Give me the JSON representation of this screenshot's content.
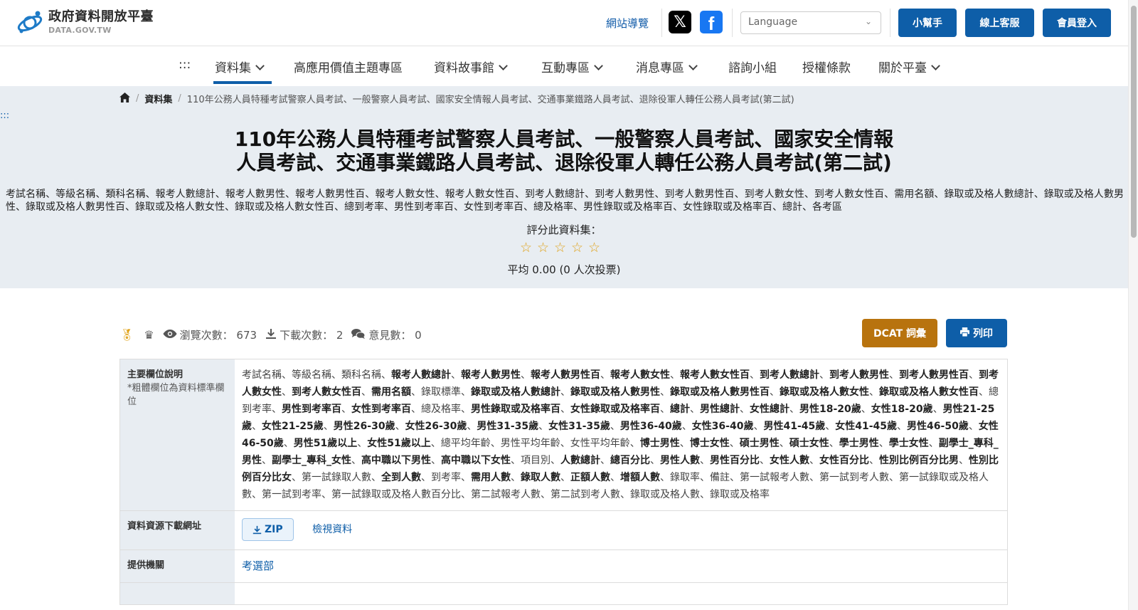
{
  "header": {
    "logo_cn": "政府資料開放平臺",
    "logo_en": "DATA.GOV.TW",
    "site_guide": "網站導覽",
    "language_placeholder": "Language",
    "buttons": {
      "helper": "小幫手",
      "support": "線上客服",
      "login": "會員登入"
    },
    "brand_color": "#0e5ea8"
  },
  "nav": {
    "accesskey": ":::",
    "items": [
      {
        "label": "資料集",
        "has_dropdown": true,
        "active": true
      },
      {
        "label": "高應用價值主題專區",
        "has_dropdown": false
      },
      {
        "label": "資料故事館",
        "has_dropdown": true
      },
      {
        "label": "互動專區",
        "has_dropdown": true
      },
      {
        "label": "消息專區",
        "has_dropdown": true
      },
      {
        "label": "諮詢小組",
        "has_dropdown": false
      },
      {
        "label": "授權條款",
        "has_dropdown": false
      },
      {
        "label": "關於平臺",
        "has_dropdown": true
      }
    ]
  },
  "breadcrumb": {
    "section": "資料集",
    "current": "110年公務人員特種考試警察人員考試、一般警察人員考試、國家安全情報人員考試、交通事業鐵路人員考試、退除役軍人轉任公務人員考試(第二試)"
  },
  "accesskey_content": ":::",
  "dataset": {
    "title_line1": "110年公務人員特種考試警察人員考試、一般警察人員考試、國家安全情報",
    "title_line2": "人員考試、交通事業鐵路人員考試、退除役軍人轉任公務人員考試(第二試)",
    "summary": "考試名稱、等級名稱、類科名稱、報考人數總計、報考人數男性、報考人數男性百、報考人數女性、報考人數女性百、到考人數總計、到考人數男性、到考人數男性百、到考人數女性、到考人數女性百、需用名額、錄取或及格人數總計、錄取或及格人數男性、錄取或及格人數男性百、錄取或及格人數女性、錄取或及格人數女性百、總到考率、男性到考率百、女性到考率百、總及格率、男性錄取或及格率百、女性錄取或及格率百、總計、各考區",
    "rate_label": "評分此資料集：",
    "rating_stars": 0,
    "rate_avg": "平均 0.00 (0 人次投票)"
  },
  "stats": {
    "views": "瀏覽次數： 673",
    "downloads": "下載次數： 2",
    "comments": "意見數： 0",
    "dcat_button": "DCAT 詞彙",
    "print_button": "列印",
    "dcat_color": "#b8730e"
  },
  "meta": {
    "fields_label": "主要欄位說明",
    "fields_note": "*粗體欄位為資料標準欄位",
    "fields": [
      {
        "t": "考試名稱",
        "b": false
      },
      {
        "t": "等級名稱",
        "b": false
      },
      {
        "t": "類科名稱",
        "b": false
      },
      {
        "t": "報考人數總計",
        "b": true
      },
      {
        "t": "報考人數男性",
        "b": true
      },
      {
        "t": "報考人數男性百",
        "b": true
      },
      {
        "t": "報考人數女性",
        "b": true
      },
      {
        "t": "報考人數女性百",
        "b": true
      },
      {
        "t": "到考人數總計",
        "b": true
      },
      {
        "t": "到考人數男性",
        "b": true
      },
      {
        "t": "到考人數男性百",
        "b": true
      },
      {
        "t": "到考人數女性",
        "b": true
      },
      {
        "t": "到考人數女性百",
        "b": true
      },
      {
        "t": "需用名額",
        "b": true
      },
      {
        "t": "錄取標準",
        "b": false
      },
      {
        "t": "錄取或及格人數總計",
        "b": true
      },
      {
        "t": "錄取或及格人數男性",
        "b": true
      },
      {
        "t": "錄取或及格人數男性百",
        "b": true
      },
      {
        "t": "錄取或及格人數女性",
        "b": true
      },
      {
        "t": "錄取或及格人數女性百",
        "b": true
      },
      {
        "t": "總到考率",
        "b": false
      },
      {
        "t": "男性到考率百",
        "b": true
      },
      {
        "t": "女性到考率百",
        "b": true
      },
      {
        "t": "總及格率",
        "b": false
      },
      {
        "t": "男性錄取或及格率百",
        "b": true
      },
      {
        "t": "女性錄取或及格率百",
        "b": true
      },
      {
        "t": "總計",
        "b": true
      },
      {
        "t": "男性總計",
        "b": true
      },
      {
        "t": "女性總計",
        "b": true
      },
      {
        "t": "男性18-20歲",
        "b": true
      },
      {
        "t": "女性18-20歲",
        "b": true
      },
      {
        "t": "男性21-25歲",
        "b": true
      },
      {
        "t": "女性21-25歲",
        "b": true
      },
      {
        "t": "男性26-30歲",
        "b": true
      },
      {
        "t": "女性26-30歲",
        "b": true
      },
      {
        "t": "男性31-35歲",
        "b": true
      },
      {
        "t": "女性31-35歲",
        "b": true
      },
      {
        "t": "男性36-40歲",
        "b": true
      },
      {
        "t": "女性36-40歲",
        "b": true
      },
      {
        "t": "男性41-45歲",
        "b": true
      },
      {
        "t": "女性41-45歲",
        "b": true
      },
      {
        "t": "男性46-50歲",
        "b": true
      },
      {
        "t": "女性46-50歲",
        "b": true
      },
      {
        "t": "男性51歲以上",
        "b": true
      },
      {
        "t": "女性51歲以上",
        "b": true
      },
      {
        "t": "總平均年齡",
        "b": false
      },
      {
        "t": "男性平均年齡",
        "b": false
      },
      {
        "t": "女性平均年齡",
        "b": false
      },
      {
        "t": "博士男性",
        "b": true
      },
      {
        "t": "博士女性",
        "b": true
      },
      {
        "t": "碩士男性",
        "b": true
      },
      {
        "t": "碩士女性",
        "b": true
      },
      {
        "t": "學士男性",
        "b": true
      },
      {
        "t": "學士女性",
        "b": true
      },
      {
        "t": "副學士_專科_男性",
        "b": true
      },
      {
        "t": "副學士_專科_女性",
        "b": true
      },
      {
        "t": "高中職以下男性",
        "b": true
      },
      {
        "t": "高中職以下女性",
        "b": true
      },
      {
        "t": "項目別",
        "b": false
      },
      {
        "t": "人數總計",
        "b": true
      },
      {
        "t": "總百分比",
        "b": true
      },
      {
        "t": "男性人數",
        "b": true
      },
      {
        "t": "男性百分比",
        "b": true
      },
      {
        "t": "女性人數",
        "b": true
      },
      {
        "t": "女性百分比",
        "b": true
      },
      {
        "t": "性別比例百分比男",
        "b": true
      },
      {
        "t": "性別比例百分比女",
        "b": true
      },
      {
        "t": "第一試錄取人數",
        "b": false
      },
      {
        "t": "全到人數",
        "b": true
      },
      {
        "t": "到考率",
        "b": false
      },
      {
        "t": "需用人數",
        "b": true
      },
      {
        "t": "錄取人數",
        "b": true
      },
      {
        "t": "正額人數",
        "b": true
      },
      {
        "t": "增額人數",
        "b": true
      },
      {
        "t": "錄取率",
        "b": false
      },
      {
        "t": "備註",
        "b": false
      },
      {
        "t": "第一試報考人數",
        "b": false
      },
      {
        "t": "第一試到考人數",
        "b": false
      },
      {
        "t": "第一試錄取或及格人數",
        "b": false
      },
      {
        "t": "第一試到考率",
        "b": false
      },
      {
        "t": "第一試錄取或及格人數百分比",
        "b": false
      },
      {
        "t": "第二試報考人數",
        "b": false
      },
      {
        "t": "第二試到考人數",
        "b": false
      },
      {
        "t": "錄取或及格人數",
        "b": false
      },
      {
        "t": "錄取或及格率",
        "b": false
      }
    ],
    "download_label": "資料資源下載網址",
    "zip_label": "ZIP",
    "view_data_label": "檢視資料",
    "agency_label": "提供機關",
    "agency_value": "考選部"
  }
}
